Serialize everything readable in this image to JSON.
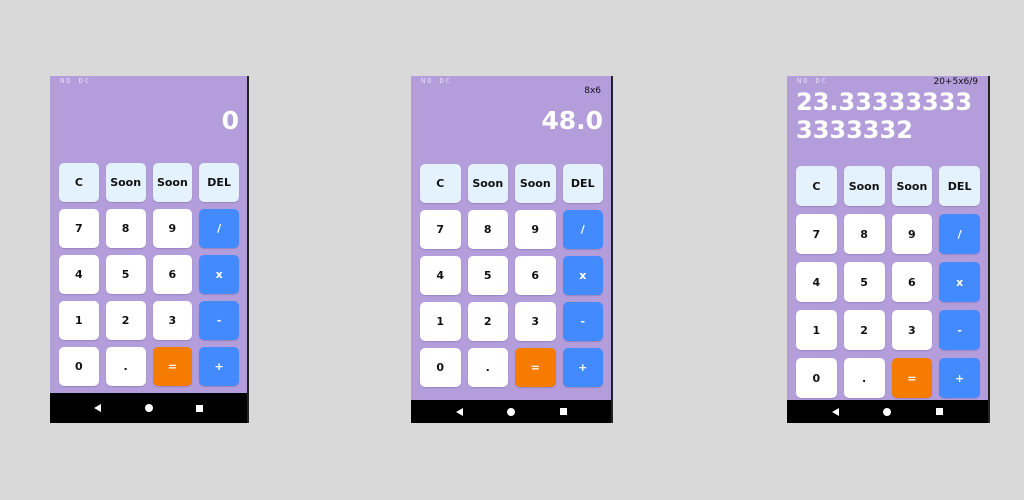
{
  "colors": {
    "background": "#d9d9d9",
    "screen": "#b39ddb",
    "key_light": "#e3f2fd",
    "key_white": "#ffffff",
    "key_operator": "#448aff",
    "key_equals": "#f57c00",
    "navbar": "#000000"
  },
  "screens": [
    {
      "status": "NO DC",
      "expression": "",
      "result": "0"
    },
    {
      "status": "NO DC",
      "expression": "8x6",
      "result": "48.0"
    },
    {
      "status": "NO DC",
      "expression": "20+5x6/9",
      "result": "23.333333333333332"
    }
  ],
  "keys": {
    "clear": "C",
    "soon1": "Soon",
    "soon2": "Soon",
    "del": "DEL",
    "seven": "7",
    "eight": "8",
    "nine": "9",
    "divide": "/",
    "four": "4",
    "five": "5",
    "six": "6",
    "multiply": "x",
    "one": "1",
    "two": "2",
    "three": "3",
    "minus": "-",
    "zero": "0",
    "dot": ".",
    "equals": "=",
    "plus": "+"
  },
  "navbar": {
    "icons": [
      "back-icon",
      "home-icon",
      "recents-icon"
    ]
  }
}
